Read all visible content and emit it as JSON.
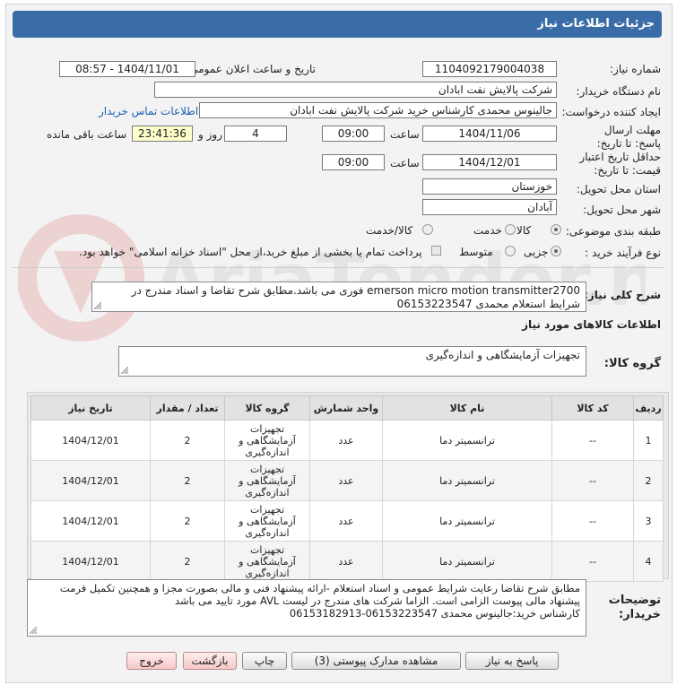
{
  "header": {
    "title": "جزئیات اطلاعات نیاز"
  },
  "labels": {
    "need_number": "شماره نیاز:",
    "announce_datetime": "تاریخ و ساعت اعلان عمومی:",
    "buyer_org": "نام دستگاه خریدار:",
    "requester": "ایجاد کننده درخواست:",
    "reply_deadline": "مهلت ارسال پاسخ: تا تاریخ:",
    "time": "ساعت",
    "days_and": "روز و",
    "hours_left": "ساعت باقی مانده",
    "price_validity": "حداقل تاریخ اعتبار قیمت: تا تاریخ:",
    "time2": "ساعت",
    "province": "استان محل تحویل:",
    "city": "شهر محل تحویل:",
    "category": "طبقه بندی موضوعی:",
    "process_type": "نوع فرآیند خرید :",
    "summary": "شرح کلی نیاز:",
    "goods_info": "اطلاعات کالاهای مورد نیاز",
    "goods_group": "گروه کالا:",
    "buyer_notes": "توضیحات خریدار:"
  },
  "fields": {
    "need_number": "1104092179004038",
    "announce_datetime": "1404/11/01 - 08:57",
    "buyer_org": "شرکت پالایش نفت ابادان",
    "requester": "جالینوس محمدی کارشناس خرید  شرکت پالایش نفت ابادان",
    "contact_link": "اطلاعات تماس خریدار",
    "reply_date": "1404/11/06",
    "reply_time": "09:00",
    "days": "4",
    "remaining_time": "23:41:36",
    "validity_date": "1404/12/01",
    "validity_time": "09:00",
    "province": "خوزستان",
    "city": "آبادان"
  },
  "category_options": [
    {
      "label": "کالا",
      "selected": true
    },
    {
      "label": "خدمت",
      "selected": false
    },
    {
      "label": "کالا/خدمت",
      "selected": false
    }
  ],
  "process_options": [
    {
      "label": "جزیی",
      "selected": true
    },
    {
      "label": "متوسط",
      "selected": false
    }
  ],
  "payment_note": "پرداخت تمام یا بخشی از مبلغ خرید،از محل \"اسناد خزانه اسلامی\" خواهد بود.",
  "summary_text": "emerson micro motion transmitter2700 فوری می باشد.مطابق شرح تقاضا و اسناد مندرج در شرایط استعلام محمدی 06153223547",
  "goods_group_text": "تجهیزات آزمایشگاهی و اندازه‌گیری",
  "table": {
    "headers": [
      "ردیف",
      "کد کالا",
      "نام کالا",
      "واحد شمارش",
      "گروه کالا",
      "تعداد / مقدار",
      "تاریخ نیاز"
    ],
    "rows": [
      [
        "1",
        "--",
        "ترانسمیتر دما",
        "عدد",
        "تجهیزات آزمایشگاهی و اندازه‌گیری",
        "2",
        "1404/12/01"
      ],
      [
        "2",
        "--",
        "ترانسمیتر دما",
        "عدد",
        "تجهیزات آزمایشگاهی و اندازه‌گیری",
        "2",
        "1404/12/01"
      ],
      [
        "3",
        "--",
        "ترانسمیتر دما",
        "عدد",
        "تجهیزات آزمایشگاهی و اندازه‌گیری",
        "2",
        "1404/12/01"
      ],
      [
        "4",
        "--",
        "ترانسمیتر دما",
        "عدد",
        "تجهیزات آزمایشگاهی و اندازه‌گیری",
        "2",
        "1404/12/01"
      ]
    ]
  },
  "notes": {
    "line1": "مطابق شرح تقاضا رعایت شرایط عمومی و اسناد استعلام -ارائه پیشنهاد فنی و مالی بصورت مجزا و همچنین تکمیل فرمت",
    "line2": "پیشنهاد مالی پیوست الزامی است. الزاما شرکت های مندرج  در لیست AVL مورد تایید می باشد",
    "line3": "کارشناس خرید:جالینوس محمدی 06153223547-06153182913"
  },
  "buttons": {
    "reply": "پاسخ به نیاز",
    "attachments": "مشاهده مدارک پیوستی (3)",
    "print": "چاپ",
    "back": "بازگشت",
    "exit": "خروج"
  },
  "watermark": "AriaTender.neT"
}
